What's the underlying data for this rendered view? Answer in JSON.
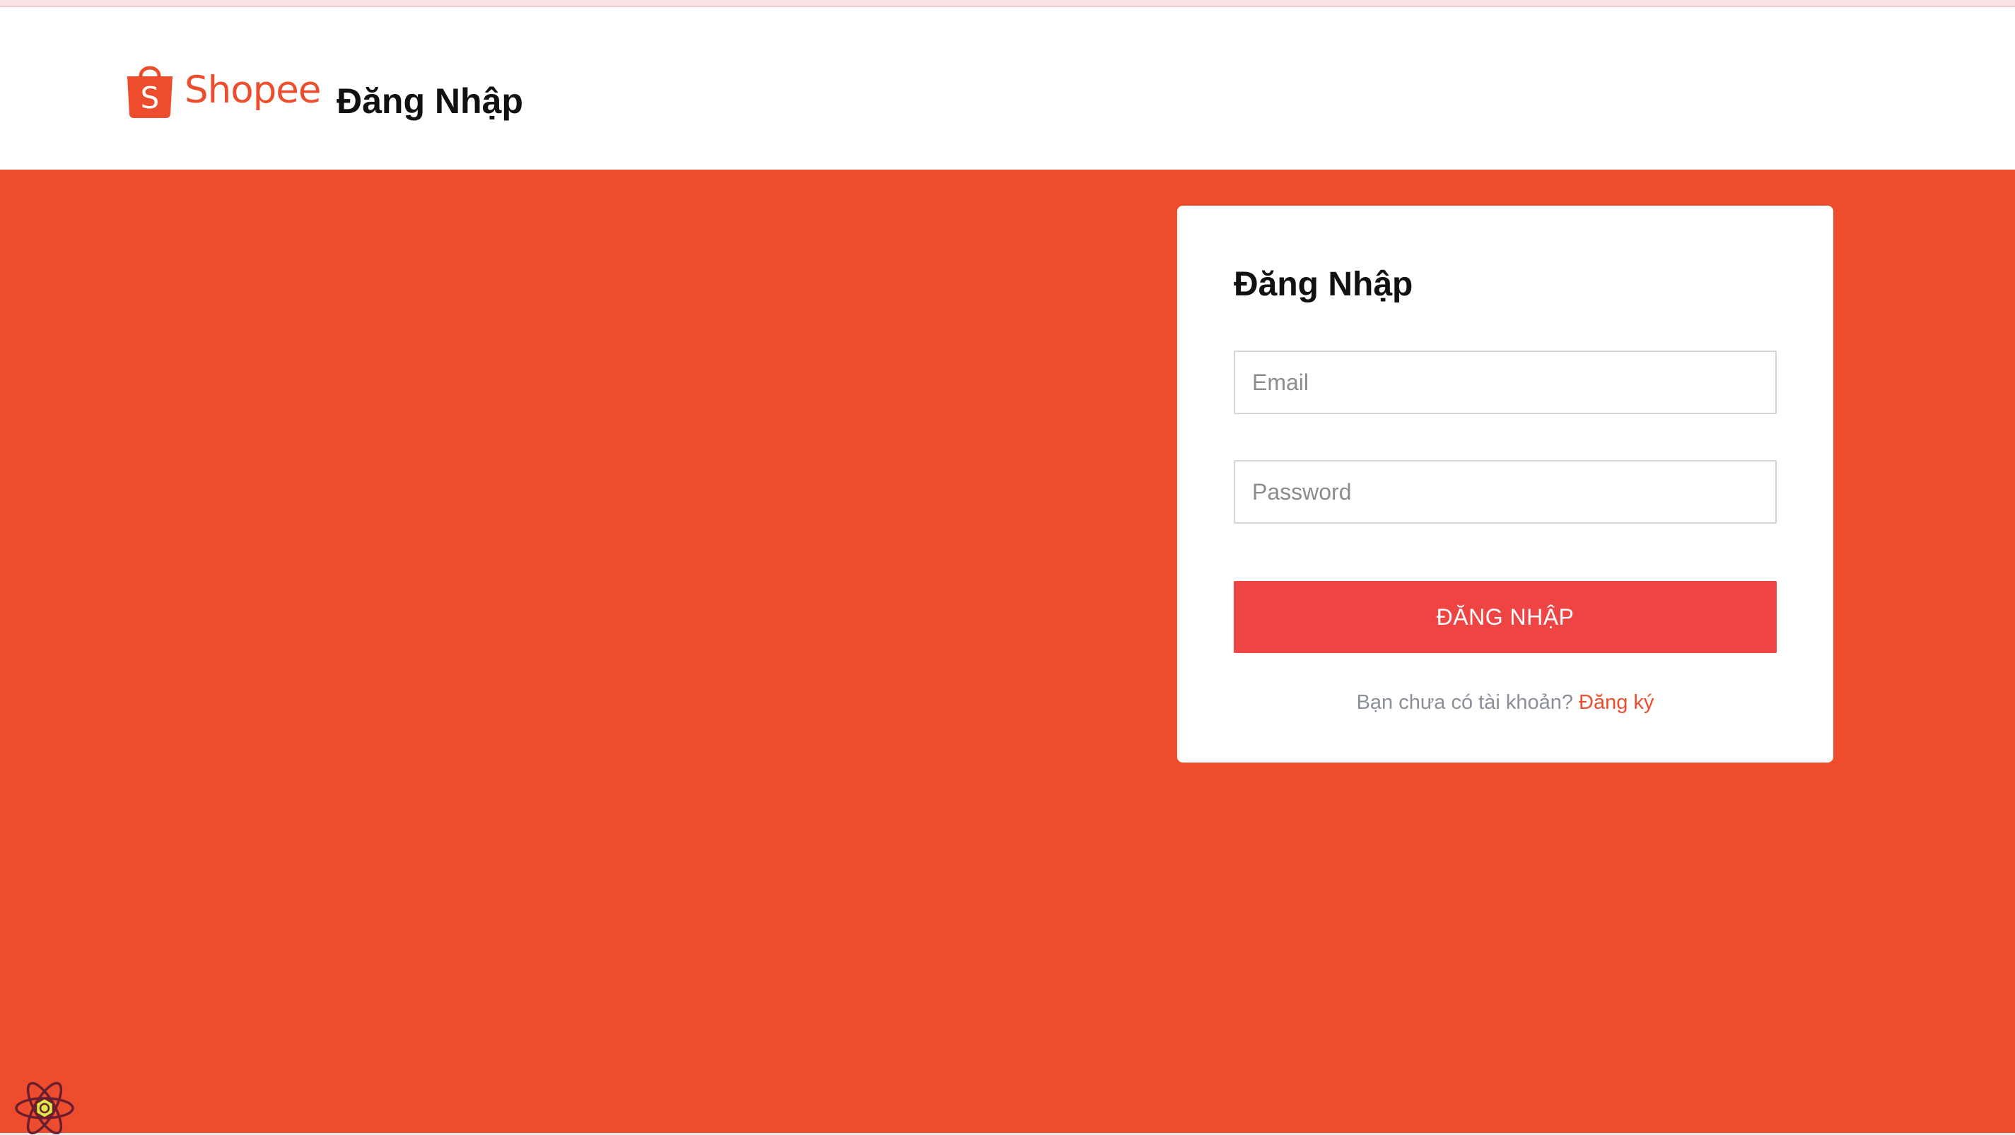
{
  "header": {
    "brand_name": "Shopee",
    "brand_letter": "S",
    "page_title": "Đăng Nhập"
  },
  "login": {
    "title": "Đăng Nhập",
    "email_placeholder": "Email",
    "password_placeholder": "Password",
    "submit_label": "ĐĂNG NHẬP",
    "register_prompt": "Bạn chưa có tài khoản?",
    "register_link": "Đăng ký"
  },
  "icons": {
    "brand": "shopping-bag-icon",
    "devtools": "react-atom-icon"
  },
  "colors": {
    "brand": "#ee4d2d",
    "button": "#ef4444",
    "muted_text": "#8a8f98"
  }
}
